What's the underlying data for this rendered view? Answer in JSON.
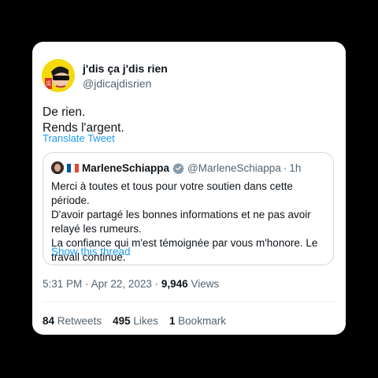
{
  "tweet": {
    "author_name": "j'dis ça j'dis rien",
    "author_handle": "@jdicajdisrien",
    "text_line1": "De rien.",
    "text_line2": "Rends l'argent.",
    "translate_label": "Translate Tweet"
  },
  "quote": {
    "name": "MarleneSchiappa",
    "handle": "@MarleneSchiappa",
    "separator": "·",
    "time": "1h",
    "body_lines": [
      "Merci à toutes et tous pour votre soutien dans cette période.",
      "D'avoir partagé les bonnes informations et ne pas avoir relayé les rumeurs.",
      "La confiance qui m'est témoignée par vous m'honore. Le travail continue."
    ],
    "show_thread": "Show this thread",
    "flag_colors": [
      "#0055a4",
      "#ffffff",
      "#ef4135"
    ]
  },
  "meta": {
    "time": "5:31 PM",
    "separator": "·",
    "date": "Apr 22, 2023",
    "views_count": "9,946",
    "views_label": "Views"
  },
  "stats": {
    "retweets_count": "84",
    "retweets_label": "Retweets",
    "likes_count": "495",
    "likes_label": "Likes",
    "bookmarks_count": "1",
    "bookmarks_label": "Bookmark"
  },
  "colors": {
    "accent": "#1d9bf0",
    "secondary_text": "#536471",
    "primary_text": "#0f1419",
    "border": "#cfd9de",
    "avatar_bg": "#f5d90a"
  }
}
